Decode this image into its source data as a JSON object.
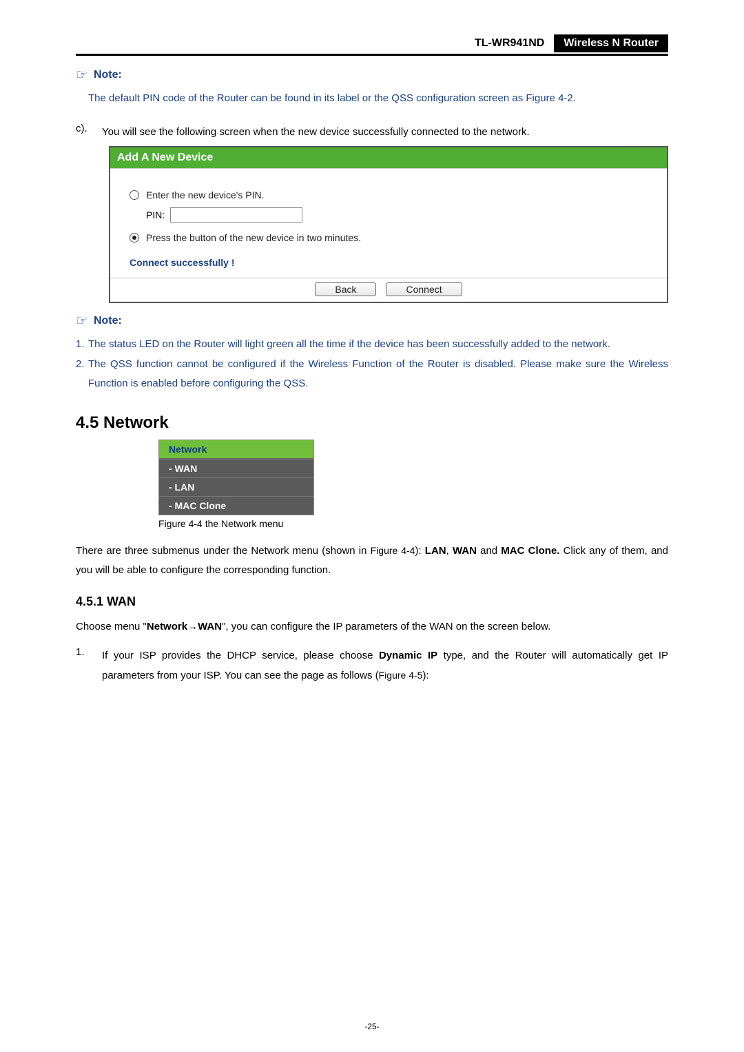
{
  "header": {
    "model": "TL-WR941ND",
    "product": "Wireless  N  Router"
  },
  "note1": {
    "label": "Note:",
    "body_prefix": "The default PIN code of the Router can be found in its label or the QSS configuration screen as ",
    "figure_ref": "Figure 4-2",
    "period": "."
  },
  "step_c": {
    "marker": "c).",
    "text": "You  will  see  the  following  screen  when  the  new  device  successfully  connected  to  the network."
  },
  "panel": {
    "title": "Add A New Device",
    "opt1": "Enter the new device's PIN.",
    "pin_label": "PIN:",
    "opt2": "Press the button of the new device in two minutes.",
    "connect_ok": "Connect successfully !",
    "back": "Back",
    "connect": "Connect"
  },
  "note2": {
    "label": "Note:",
    "item1": "The  status  LED  on  the  Router  will light  green  all  the  time  if  the  device  has  been  successfully added to the network.",
    "item2": "The  QSS  function  cannot  be  configured  if  the  Wireless  Function  of  the  Router  is  disabled. Please make sure the Wireless Function is enabled before configuring the QSS."
  },
  "section": {
    "heading": "4.5  Network",
    "menu_head": "Network",
    "menu_items": [
      "- WAN",
      "- LAN",
      "- MAC Clone"
    ],
    "caption": "Figure 4-4    the Network menu",
    "para_a": "There are three submenus under the Network menu (shown in ",
    "para_b": "Figure 4-4",
    "para_c": "): ",
    "bold1": "LAN",
    "comma": ", ",
    "bold2": "WAN",
    "and": " and ",
    "bold3": "MAC Clone.",
    "para_d": " Click any of them, and you will be able to configure the corresponding function."
  },
  "wan": {
    "heading": "4.5.1  WAN",
    "p1a": "Choose menu \"",
    "p1b": "Network",
    "arrow": "→",
    "p1c": "WAN",
    "p1d": "\", you can configure the IP parameters of the WAN on the screen below.",
    "li_marker": "1.",
    "li_a": "If your ISP provides the DHCP service, please choose ",
    "li_b": "Dynamic IP",
    "li_c": " type, and the Router will automatically get IP parameters from your ISP. You can see the page as follows (",
    "li_d": "Figure 4-5",
    "li_e": "):"
  },
  "page_number": "-25-"
}
